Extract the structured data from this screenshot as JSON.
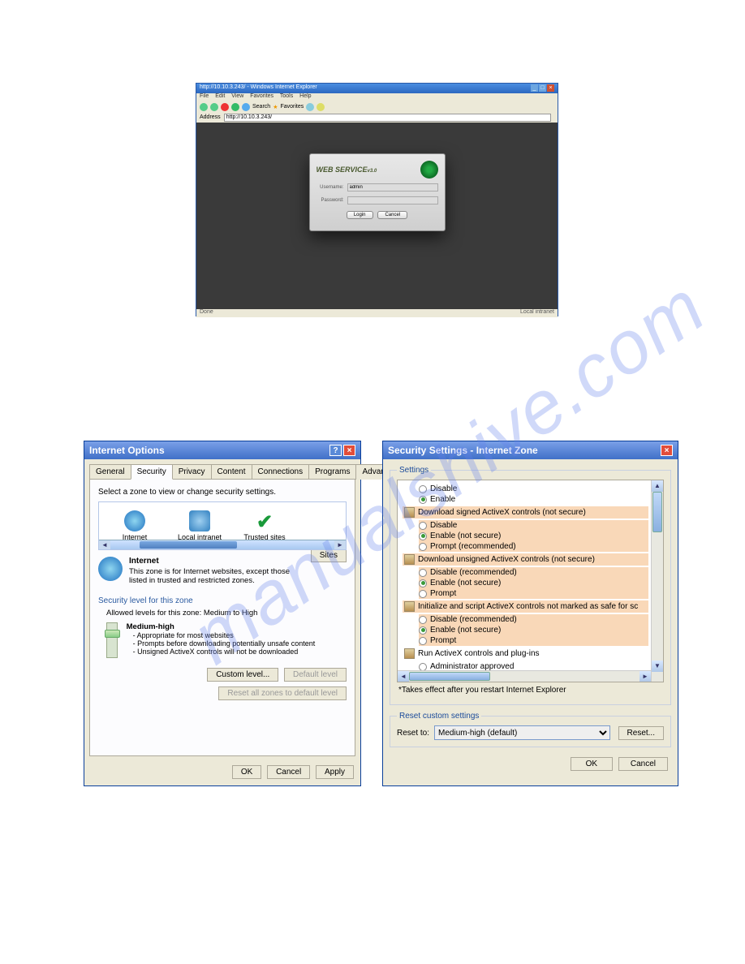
{
  "watermark": "manualshive.com",
  "browser": {
    "title": "http://10.10.3.243/ - Windows Internet Explorer",
    "menu": [
      "File",
      "Edit",
      "View",
      "Favorites",
      "Tools",
      "Help"
    ],
    "toolbar": {
      "search": "Search",
      "favorites": "Favorites"
    },
    "address_label": "Address",
    "address_value": "http://10.10.3.243/",
    "status_left": "Done",
    "status_right": "Local intranet",
    "login": {
      "title": "WEB  SERVICE",
      "version": "v3.0",
      "username_label": "Username:",
      "username_value": "admin",
      "password_label": "Password:",
      "password_value": "",
      "login_btn": "Login",
      "cancel_btn": "Cancel"
    }
  },
  "dlgA": {
    "title": "Internet Options",
    "tabs": [
      "General",
      "Security",
      "Privacy",
      "Content",
      "Connections",
      "Programs",
      "Advanced"
    ],
    "active_tab": 1,
    "prompt": "Select a zone to view or change security settings.",
    "zones": [
      {
        "id": "internet",
        "label": "Internet"
      },
      {
        "id": "intranet",
        "label": "Local intranet"
      },
      {
        "id": "trusted",
        "label": "Trusted sites"
      }
    ],
    "zone_name": "Internet",
    "zone_desc": "This zone is for Internet websites, except those listed in trusted and restricted zones.",
    "sites_btn": "Sites",
    "sec_header": "Security level for this zone",
    "allowed": "Allowed levels for this zone: Medium to High",
    "level_name": "Medium-high",
    "bullets": [
      "- Appropriate for most websites",
      "- Prompts before downloading potentially unsafe content",
      "- Unsigned ActiveX controls will not be downloaded"
    ],
    "custom_btn": "Custom level...",
    "default_btn": "Default level",
    "reset_all_btn": "Reset all zones to default level",
    "ok": "OK",
    "cancel": "Cancel",
    "apply": "Apply"
  },
  "dlgB": {
    "title": "Security Settings - Internet Zone",
    "settings_legend": "Settings",
    "items": [
      {
        "type": "opt",
        "label": "Disable",
        "sel": false,
        "hl": false
      },
      {
        "type": "opt",
        "label": "Enable",
        "sel": true,
        "hl": false
      },
      {
        "type": "hdr",
        "label": "Download signed ActiveX controls (not secure)",
        "hl": true
      },
      {
        "type": "opt",
        "label": "Disable",
        "sel": false,
        "hl": true
      },
      {
        "type": "opt",
        "label": "Enable (not secure)",
        "sel": true,
        "hl": true
      },
      {
        "type": "opt",
        "label": "Prompt (recommended)",
        "sel": false,
        "hl": true
      },
      {
        "type": "hdr",
        "label": "Download unsigned ActiveX controls (not secure)",
        "hl": true
      },
      {
        "type": "opt",
        "label": "Disable (recommended)",
        "sel": false,
        "hl": true
      },
      {
        "type": "opt",
        "label": "Enable (not secure)",
        "sel": true,
        "hl": true
      },
      {
        "type": "opt",
        "label": "Prompt",
        "sel": false,
        "hl": true
      },
      {
        "type": "hdr",
        "label": "Initialize and script ActiveX controls not marked as safe for sc",
        "hl": true
      },
      {
        "type": "opt",
        "label": "Disable (recommended)",
        "sel": false,
        "hl": true
      },
      {
        "type": "opt",
        "label": "Enable (not secure)",
        "sel": true,
        "hl": true
      },
      {
        "type": "opt",
        "label": "Prompt",
        "sel": false,
        "hl": true
      },
      {
        "type": "hdr",
        "label": "Run ActiveX controls and plug-ins",
        "hl": false
      },
      {
        "type": "opt",
        "label": "Administrator approved",
        "sel": false,
        "hl": false
      }
    ],
    "note": "*Takes effect after you restart Internet Explorer",
    "reset_legend": "Reset custom settings",
    "reset_label": "Reset to:",
    "reset_value": "Medium-high (default)",
    "reset_btn": "Reset...",
    "ok": "OK",
    "cancel": "Cancel"
  }
}
